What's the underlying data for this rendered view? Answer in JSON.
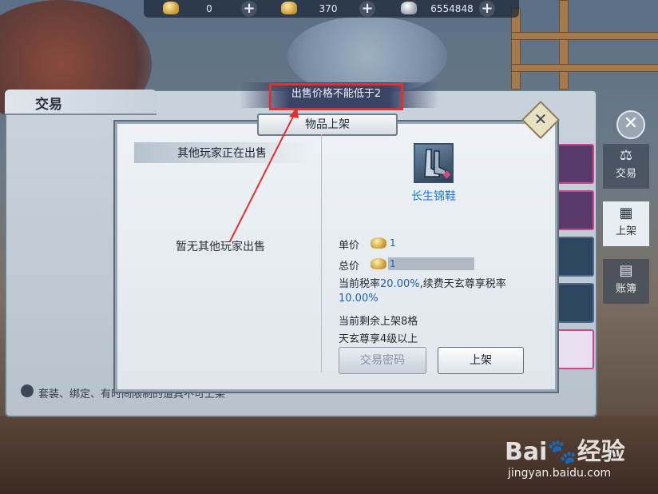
{
  "currency": {
    "gold": "0",
    "yuanbao": "370",
    "silver": "6554848"
  },
  "panel": {
    "title": "交易",
    "hint": "套装、绑定、有时间限制的道具不可上架"
  },
  "side_tabs": [
    {
      "label": "交易",
      "icon": "trade-icon"
    },
    {
      "label": "上架",
      "icon": "shelf-icon",
      "active": true
    },
    {
      "label": "账簿",
      "icon": "ledger-icon"
    }
  ],
  "toast": {
    "text": "出售价格不能低于2"
  },
  "modal": {
    "title": "物品上架",
    "left_header": "其他玩家正在出售",
    "empty_text": "暂无其他玩家出售",
    "item_name": "长生锦鞋",
    "unit_price_label": "单价",
    "unit_price": "1",
    "total_price_label": "总价",
    "total_price": "1",
    "tax_prefix": "当前税率",
    "tax_rate": "20.00%",
    "tax_mid": ",续费天玄尊享税率",
    "tax_rate_vip": "10.00%",
    "remaining": "当前剩余上架8格",
    "requirement": "天玄尊享4级以上",
    "btn_password": "交易密码",
    "btn_list": "上架"
  },
  "watermark": {
    "brand": "Bai du 经验",
    "url": "jingyan.baidu.com"
  },
  "colors": {
    "accent_blue": "#1b61b8",
    "toast_border": "#e0312f",
    "item_name": "#1b7ad0"
  }
}
